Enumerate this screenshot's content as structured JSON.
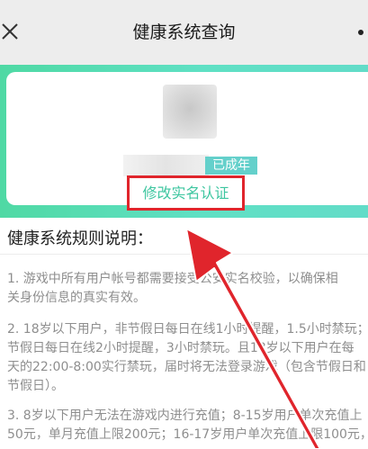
{
  "header": {
    "title": "健康系统查询",
    "close_icon": "close-icon",
    "more_icon": "more-icon"
  },
  "profile": {
    "badge": "已成年",
    "modify_link": "修改实名认证"
  },
  "rules": {
    "title": "健康系统规则说明：",
    "paragraphs": [
      [
        "1. 游戏中所有用户帐号都需要接受公安实名校验，以确保相",
        "关身份信息的真实有效。"
      ],
      [
        "2. 18岁以下用户，非节假日每日在线1小时提醒，1.5小时禁玩；",
        "节假日每日在线2小时提醒，3小时禁玩。且18岁以下用户在每",
        "天的22:00-8:00实行禁玩，届时将无法登录游戏（包含节假日和",
        "节假日）。"
      ],
      [
        "3. 8岁以下用户无法在游戏内进行充值；8-15岁用户单次充值上",
        "50元，单月充值上限200元；16-17岁用户单次充值上限100元，"
      ]
    ]
  },
  "colors": {
    "accent": "#3ec6a0",
    "banner": "#5fe0c4",
    "annotation": "#e0252c"
  }
}
